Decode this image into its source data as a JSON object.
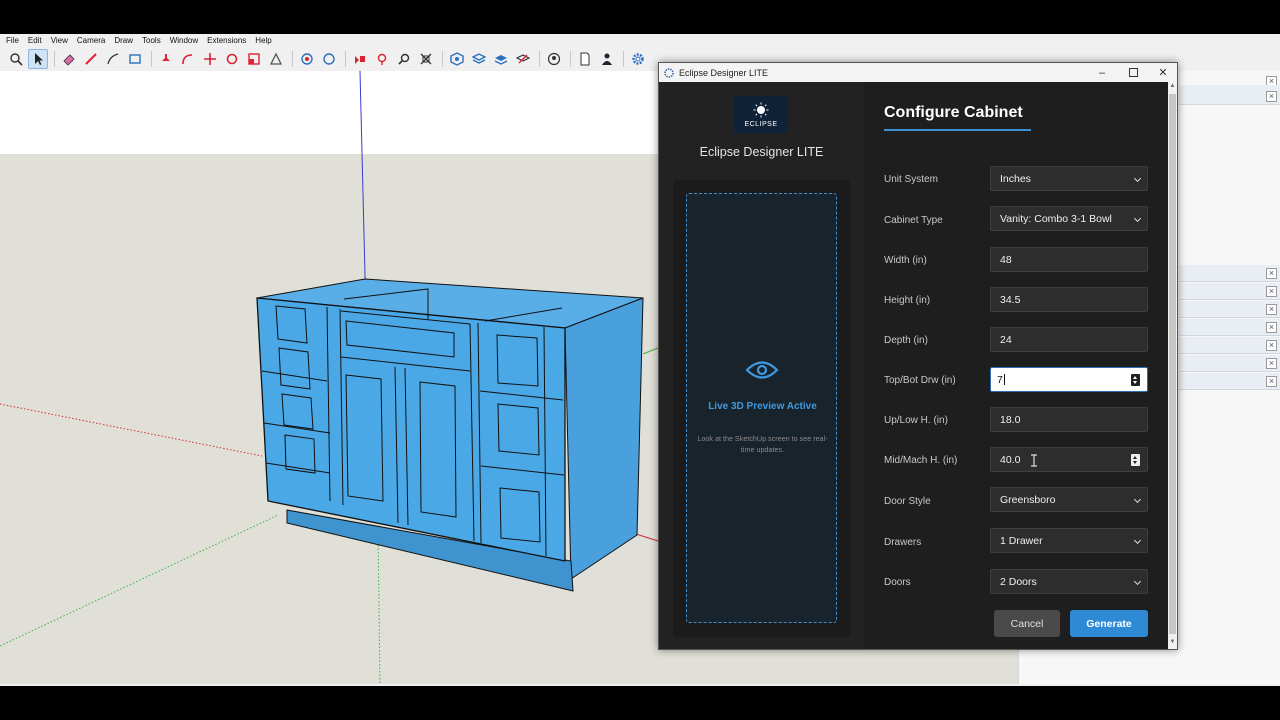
{
  "menu": [
    "File",
    "Edit",
    "View",
    "Camera",
    "Draw",
    "Tools",
    "Window",
    "Extensions",
    "Help"
  ],
  "toolbar_icons": [
    "search-icon",
    "select-icon",
    "eraser-icon",
    "pencil-icon",
    "line-icon",
    "rectangle-icon",
    "push-pull-icon",
    "follow-me-icon",
    "move-icon",
    "rotate-icon",
    "scale-icon",
    "offset-icon",
    "orbit-icon",
    "pan-icon",
    "zoom-icon",
    "zoom-window-icon",
    "zoom-extents-icon",
    "component-icon",
    "layers-icon",
    "styles-icon",
    "sections-icon",
    "user-icon",
    "document-icon",
    "person-icon",
    "gear-icon"
  ],
  "dialog": {
    "title": "Eclipse Designer LITE",
    "logo_text": "ECLIPSE",
    "app_name": "Eclipse Designer LITE",
    "preview": {
      "title": "Live 3D Preview Active",
      "hint": "Look at the SketchUp screen to see real-time updates."
    },
    "heading": "Configure Cabinet",
    "fields": {
      "unit_system": {
        "label": "Unit System",
        "value": "Inches"
      },
      "cabinet_type": {
        "label": "Cabinet Type",
        "value": "Vanity: Combo 3-1 Bowl"
      },
      "width": {
        "label": "Width (in)",
        "value": "48"
      },
      "height": {
        "label": "Height (in)",
        "value": "34.5"
      },
      "depth": {
        "label": "Depth (in)",
        "value": "24"
      },
      "top_bot_drw": {
        "label": "Top/Bot Drw (in)",
        "value": "7"
      },
      "up_low_h": {
        "label": "Up/Low H. (in)",
        "value": "18.0"
      },
      "mid_mach_h": {
        "label": "Mid/Mach H. (in)",
        "value": "40.0"
      },
      "door_style": {
        "label": "Door Style",
        "value": "Greensboro"
      },
      "drawers": {
        "label": "Drawers",
        "value": "1 Drawer"
      },
      "doors": {
        "label": "Doors",
        "value": "2 Doors"
      }
    },
    "cancel_label": "Cancel",
    "generate_label": "Generate"
  },
  "colors": {
    "accent": "#2f8ad6",
    "cabinet_fill": "#4aa8e6",
    "dialog_bg": "#1e1e1e"
  }
}
